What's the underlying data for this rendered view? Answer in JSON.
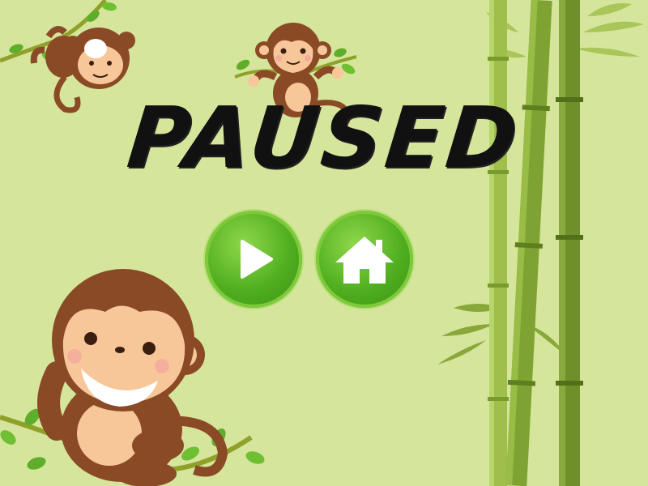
{
  "screen": {
    "title": "PAUSED",
    "state": "paused"
  },
  "buttons": {
    "play": {
      "icon": "play-icon"
    },
    "home": {
      "icon": "home-icon"
    }
  },
  "colors": {
    "background": "#d5e59b",
    "button_green": "#4fae1e",
    "title_text": "#111111",
    "monkey_brown": "#8b4a26",
    "monkey_face": "#f7c79a",
    "bamboo": "#8cb23a"
  }
}
